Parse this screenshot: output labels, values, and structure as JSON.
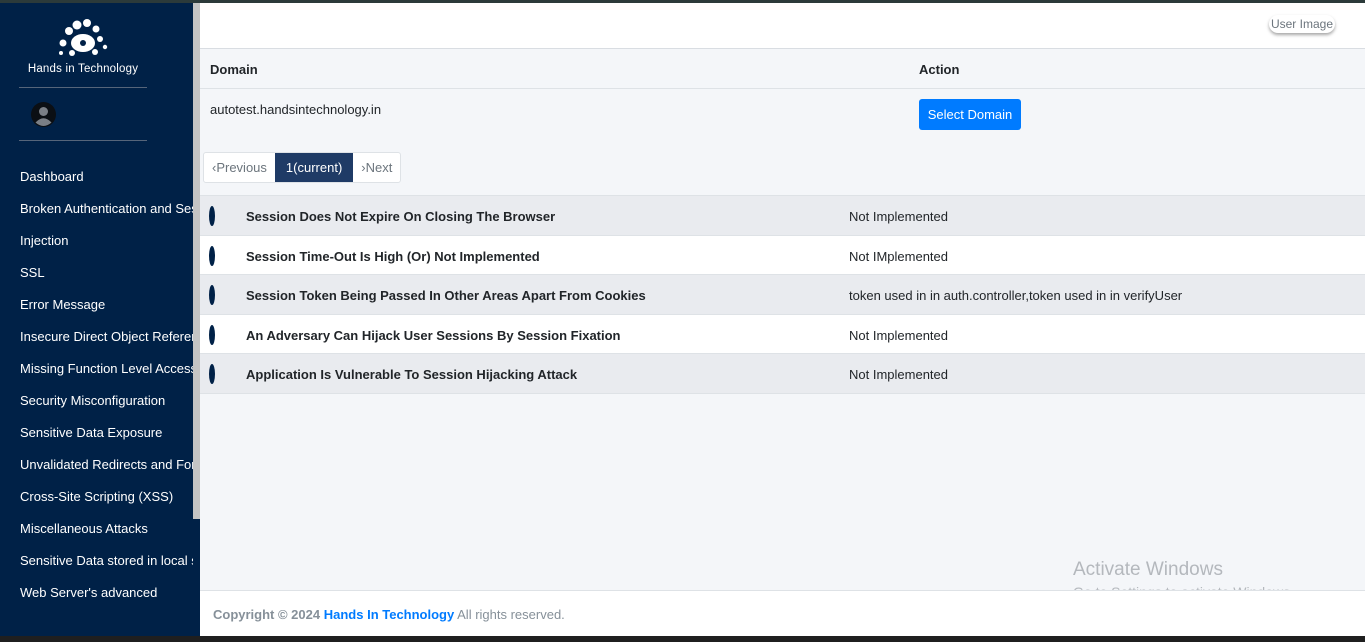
{
  "sidebar": {
    "brand": "Hands in Technology",
    "items": [
      {
        "label": "Dashboard"
      },
      {
        "label": "Broken Authentication and Session Management"
      },
      {
        "label": "Injection"
      },
      {
        "label": "SSL"
      },
      {
        "label": "Error Message"
      },
      {
        "label": "Insecure Direct Object References"
      },
      {
        "label": "Missing Function Level Access Control"
      },
      {
        "label": "Security Misconfiguration"
      },
      {
        "label": "Sensitive Data Exposure"
      },
      {
        "label": "Unvalidated Redirects and Forwards"
      },
      {
        "label": "Cross-Site Scripting (XSS)"
      },
      {
        "label": "Miscellaneous Attacks"
      },
      {
        "label": "Sensitive Data stored in local storage"
      },
      {
        "label": "Web Server's advanced"
      }
    ]
  },
  "header": {
    "user_image_alt": "User Image"
  },
  "domain_table": {
    "col_domain": "Domain",
    "col_action": "Action",
    "rows": [
      {
        "domain": "autotest.handsintechnology.in",
        "action": "Select Domain"
      }
    ]
  },
  "pagination": {
    "previous": "‹Previous",
    "current": "1(current)",
    "next": "›Next"
  },
  "vulnerabilities": [
    {
      "name": "Session Does Not Expire On Closing The Browser",
      "status": "Not Implemented"
    },
    {
      "name": "Session Time-Out Is High (Or) Not Implemented",
      "status": "Not IMplemented"
    },
    {
      "name": "Session Token Being Passed In Other Areas Apart From Cookies",
      "status": "token used in in auth.controller,token used in in verifyUser"
    },
    {
      "name": "An Adversary Can Hijack User Sessions By Session Fixation",
      "status": "Not Implemented"
    },
    {
      "name": "Application Is Vulnerable To Session Hijacking Attack",
      "status": "Not Implemented"
    }
  ],
  "watermark": {
    "line1": "Activate Windows",
    "line2": "Go to Settings to activate Windows."
  },
  "footer": {
    "prefix": "Copyright © 2024",
    "company": "Hands In Technology",
    "suffix": "All rights reserved."
  },
  "colors": {
    "sidebar_bg": "#002147",
    "primary": "#007bff",
    "pager_active": "#1f3b66"
  }
}
